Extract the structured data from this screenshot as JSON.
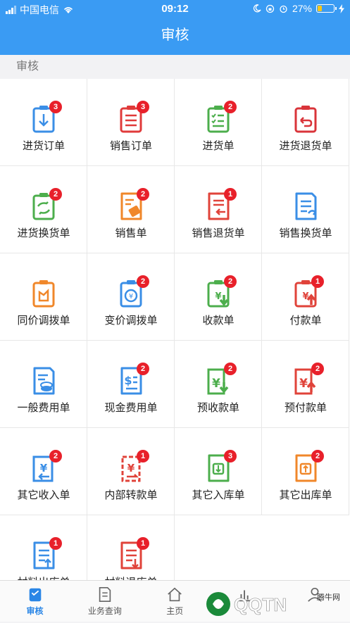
{
  "status": {
    "carrier": "中国电信",
    "time": "09:12",
    "battery": "27%",
    "battery_level": 0.27
  },
  "nav": {
    "title": "审核"
  },
  "section": {
    "title": "审核"
  },
  "tiles": [
    {
      "label": "进货订单",
      "badge": "3",
      "icon": "download-clipboard-icon",
      "color": "#3a8ee6"
    },
    {
      "label": "销售订单",
      "badge": "3",
      "icon": "list-clipboard-icon",
      "color": "#e03a3a"
    },
    {
      "label": "进货单",
      "badge": "2",
      "icon": "checklist-clipboard-icon",
      "color": "#4cae4c"
    },
    {
      "label": "进货退货单",
      "badge": "",
      "icon": "return-clipboard-icon",
      "color": "#d9343a"
    },
    {
      "label": "进货换货单",
      "badge": "2",
      "icon": "exchange-clipboard-icon",
      "color": "#4cae4c"
    },
    {
      "label": "销售单",
      "badge": "2",
      "icon": "tag-document-icon",
      "color": "#f0872a"
    },
    {
      "label": "销售退货单",
      "badge": "1",
      "icon": "return-document-icon",
      "color": "#e0433a"
    },
    {
      "label": "销售换货单",
      "badge": "",
      "icon": "exchange-document-icon",
      "color": "#3a8ee6"
    },
    {
      "label": "同价调拨单",
      "badge": "",
      "icon": "transfer-clipboard-icon",
      "color": "#f0872a"
    },
    {
      "label": "变价调拨单",
      "badge": "2",
      "icon": "currency-transfer-icon",
      "color": "#3a8ee6"
    },
    {
      "label": "收款单",
      "badge": "2",
      "icon": "receipt-down-icon",
      "color": "#4cae4c"
    },
    {
      "label": "付款单",
      "badge": "1",
      "icon": "payment-up-icon",
      "color": "#e0433a"
    },
    {
      "label": "一般费用单",
      "badge": "",
      "icon": "coins-document-icon",
      "color": "#3a8ee6"
    },
    {
      "label": "现金费用单",
      "badge": "2",
      "icon": "cash-document-icon",
      "color": "#3a8ee6"
    },
    {
      "label": "预收款单",
      "badge": "2",
      "icon": "yen-down-icon",
      "color": "#4cae4c"
    },
    {
      "label": "预付款单",
      "badge": "2",
      "icon": "yen-up-icon",
      "color": "#e0433a"
    },
    {
      "label": "其它收入单",
      "badge": "2",
      "icon": "yen-in-icon",
      "color": "#3a8ee6"
    },
    {
      "label": "内部转款单",
      "badge": "1",
      "icon": "yen-transfer-icon",
      "color": "#e0433a"
    },
    {
      "label": "其它入库单",
      "badge": "3",
      "icon": "stock-in-icon",
      "color": "#4cae4c"
    },
    {
      "label": "其它出库单",
      "badge": "2",
      "icon": "stock-out-icon",
      "color": "#f0872a"
    },
    {
      "label": "材料出库单",
      "badge": "1",
      "icon": "material-out-icon",
      "color": "#3a8ee6"
    },
    {
      "label": "材料退库单",
      "badge": "1",
      "icon": "material-return-icon",
      "color": "#e0433a"
    }
  ],
  "tabs": [
    {
      "label": "审核",
      "icon": "audit-icon",
      "active": true
    },
    {
      "label": "业务查询",
      "icon": "document-icon",
      "active": false
    },
    {
      "label": "主页",
      "icon": "home-icon",
      "active": false
    },
    {
      "label": "",
      "icon": "chart-icon",
      "active": false
    },
    {
      "label": "",
      "icon": "user-icon",
      "active": false
    }
  ],
  "watermark": {
    "brand": "QQTN",
    "site": "腾牛网"
  }
}
